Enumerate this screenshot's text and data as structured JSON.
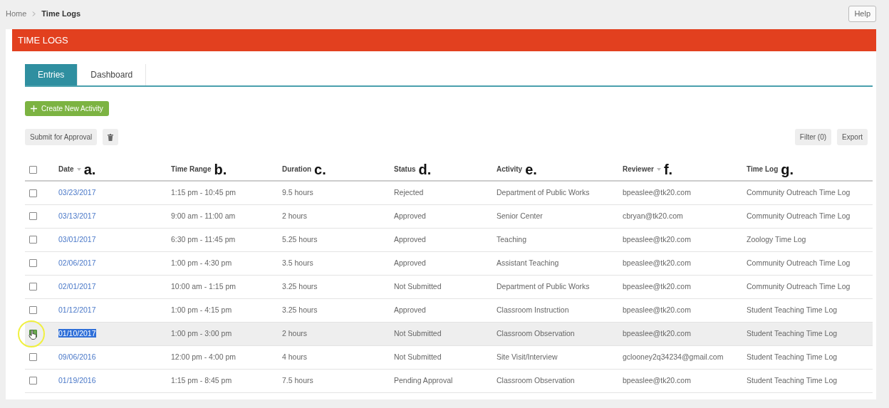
{
  "breadcrumb": [
    {
      "label": "Home",
      "current": false
    },
    {
      "label": "Time Logs",
      "current": true
    }
  ],
  "help_button": "Help",
  "panel_title": "TIME LOGS",
  "tabs": [
    {
      "label": "Entries",
      "selected": true
    },
    {
      "label": "Dashboard",
      "selected": false
    }
  ],
  "create_button": "Create New Activity",
  "submit_button": "Submit for Approval",
  "filter_button": "Filter (0)",
  "export_button": "Export",
  "table": {
    "select_all_checked": false,
    "columns": [
      {
        "label": "Date",
        "sorted": true,
        "annotation": "a."
      },
      {
        "label": "Time Range",
        "annotation": "b."
      },
      {
        "label": "Duration",
        "annotation": "c."
      },
      {
        "label": "Status",
        "annotation": "d."
      },
      {
        "label": "Activity",
        "annotation": "e."
      },
      {
        "label": "Reviewer",
        "sorted": true,
        "annotation": "f."
      },
      {
        "label": "Time Log",
        "annotation": "g."
      }
    ],
    "rows": [
      {
        "checked": false,
        "selected": false,
        "cells": [
          "03/23/2017",
          "1:15 pm - 10:45 pm",
          "9.5 hours",
          "Rejected",
          "Department of Public Works",
          "bpeaslee@tk20.com",
          "Community Outreach Time Log"
        ]
      },
      {
        "checked": false,
        "selected": false,
        "cells": [
          "03/13/2017",
          "9:00 am - 11:00 am",
          "2 hours",
          "Approved",
          "Senior Center",
          "cbryan@tk20.com",
          "Community Outreach Time Log"
        ]
      },
      {
        "checked": false,
        "selected": false,
        "cells": [
          "03/01/2017",
          "6:30 pm - 11:45 pm",
          "5.25 hours",
          "Approved",
          "Teaching",
          "bpeaslee@tk20.com",
          "Zoology Time Log"
        ]
      },
      {
        "checked": false,
        "selected": false,
        "cells": [
          "02/06/2017",
          "1:00 pm - 4:30 pm",
          "3.5 hours",
          "Approved",
          "Assistant Teaching",
          "bpeaslee@tk20.com",
          "Community Outreach Time Log"
        ]
      },
      {
        "checked": false,
        "selected": false,
        "cells": [
          "02/01/2017",
          "10:00 am - 1:15 pm",
          "3.25 hours",
          "Not Submitted",
          "Department of Public Works",
          "bpeaslee@tk20.com",
          "Community Outreach Time Log"
        ]
      },
      {
        "checked": false,
        "selected": false,
        "cells": [
          "01/12/2017",
          "1:00 pm - 4:15 pm",
          "3.25 hours",
          "Approved",
          "Classroom Instruction",
          "bpeaslee@tk20.com",
          "Student Teaching Time Log"
        ]
      },
      {
        "checked": true,
        "selected": true,
        "cells": [
          "01/10/2017",
          "1:00 pm - 3:00 pm",
          "2 hours",
          "Not Submitted",
          "Classroom Observation",
          "bpeaslee@tk20.com",
          "Student Teaching Time Log"
        ]
      },
      {
        "checked": false,
        "selected": false,
        "cells": [
          "09/06/2016",
          "12:00 pm - 4:00 pm",
          "4 hours",
          "Not Submitted",
          "Site Visit/Interview",
          "gclooney2q34234@gmail.com",
          "Student Teaching Time Log"
        ]
      },
      {
        "checked": false,
        "selected": false,
        "cells": [
          "01/19/2016",
          "1:15 pm - 8:45 pm",
          "7.5 hours",
          "Pending Approval",
          "Classroom Observation",
          "bpeaslee@tk20.com",
          "Student Teaching Time Log"
        ]
      }
    ]
  }
}
